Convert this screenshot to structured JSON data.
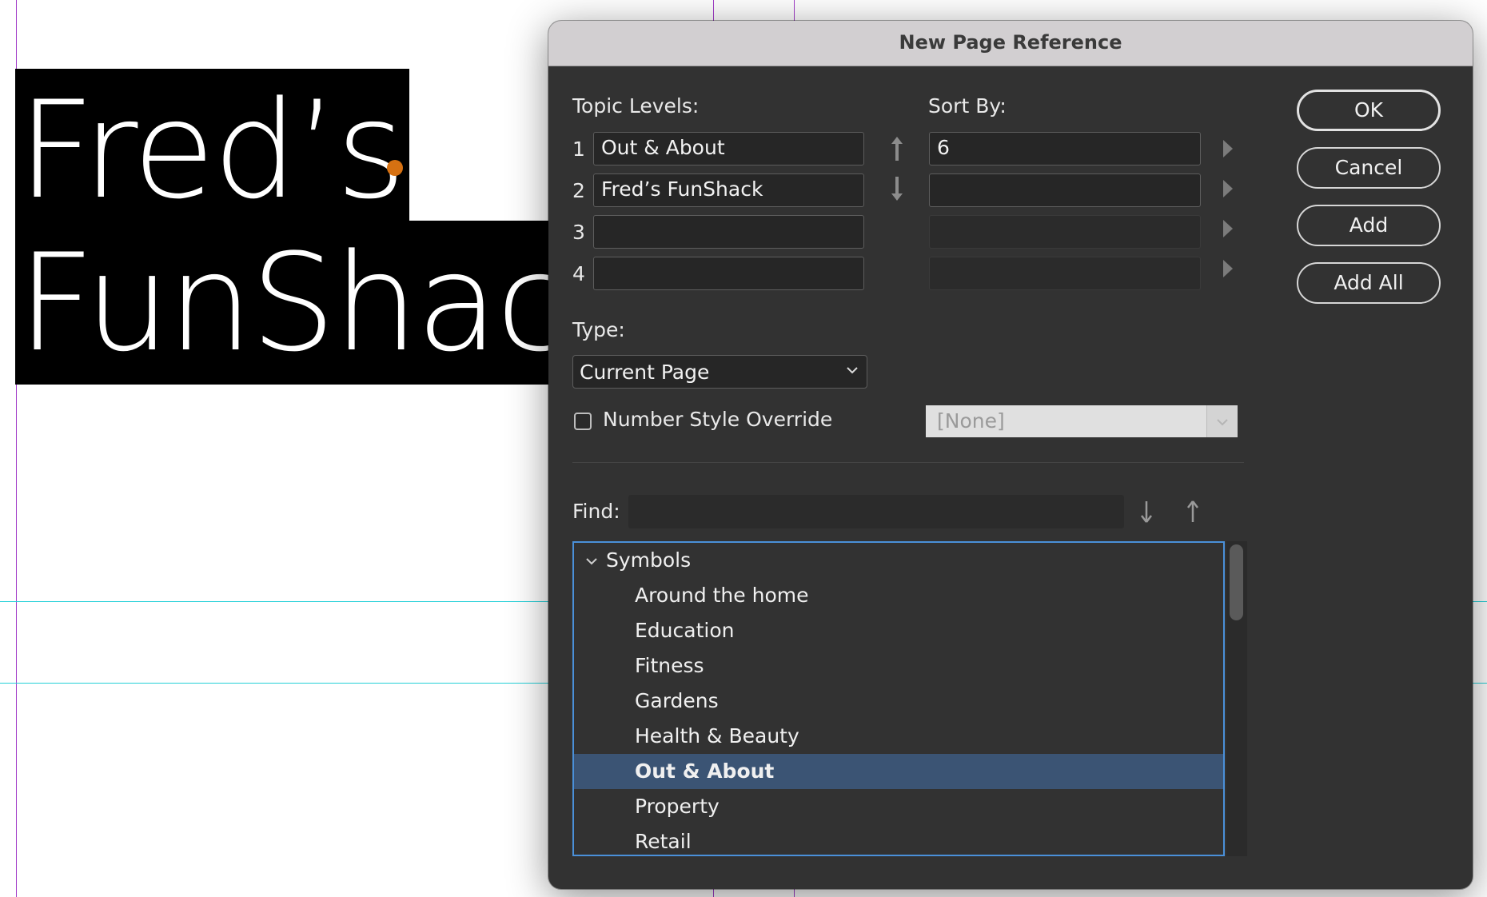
{
  "document": {
    "line1": "Fred’s",
    "line2": "FunShack"
  },
  "dialog": {
    "title": "New Page Reference",
    "topic_levels_label": "Topic Levels:",
    "sort_by_label": "Sort By:",
    "levels": [
      {
        "num": "1",
        "value": "Out & About",
        "sort": "6"
      },
      {
        "num": "2",
        "value": "Fred’s FunShack",
        "sort": ""
      },
      {
        "num": "3",
        "value": "",
        "sort": ""
      },
      {
        "num": "4",
        "value": "",
        "sort": ""
      }
    ],
    "type_label": "Type:",
    "type_value": "Current Page",
    "number_style_override_label": "Number Style Override",
    "number_style_override_checked": false,
    "number_style_value": "[None]",
    "find_label": "Find:",
    "find_value": "",
    "buttons": {
      "ok": "OK",
      "cancel": "Cancel",
      "add": "Add",
      "add_all": "Add All"
    },
    "topics": {
      "group": "Symbols",
      "items": [
        "Around the home",
        "Education",
        "Fitness",
        "Gardens",
        "Health & Beauty",
        "Out & About",
        "Property",
        "Retail"
      ],
      "selected": "Out & About"
    },
    "colors": {
      "selection": "#3b5474",
      "focus_ring": "#4a90d9",
      "overset_marker": "#d67112"
    }
  }
}
